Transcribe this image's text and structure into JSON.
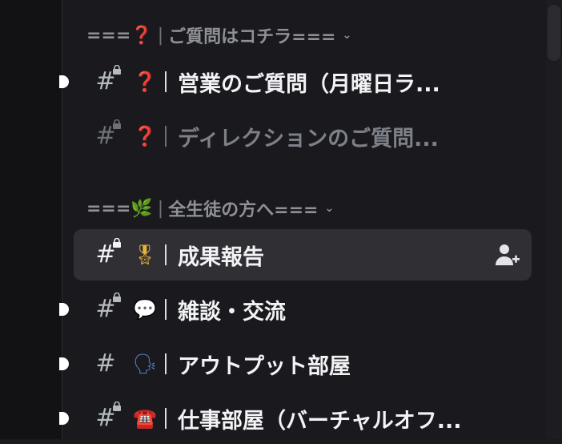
{
  "categories": [
    {
      "prefix": "===",
      "emoji": "❓",
      "separator": "|",
      "title": "ご質問はコチラ===",
      "chevron": "chevron-down"
    },
    {
      "prefix": "===",
      "emoji": "🌿",
      "separator": "|",
      "title": "全生徒の方へ===",
      "chevron": "chevron-down"
    }
  ],
  "channels": [
    {
      "hash": "#",
      "emoji": "❓",
      "separator": "|",
      "name": "営業のご質問（月曜日ラ...",
      "unread": true,
      "locked": true
    },
    {
      "hash": "#",
      "emoji": "❓",
      "separator": "|",
      "name": "ディレクションのご質問...",
      "unread": false,
      "locked": true,
      "muted": true
    },
    {
      "hash": "#",
      "emoji": "🎖",
      "separator": "|",
      "name": "成果報告",
      "unread": false,
      "locked": true,
      "selected": true,
      "icon": "add-member-icon"
    },
    {
      "hash": "#",
      "emoji": "💬",
      "separator": "|",
      "name": "雑談・交流",
      "unread": true,
      "locked": true
    },
    {
      "hash": "#",
      "emoji": "🗣",
      "separator": "|",
      "name": "アウトプット部屋",
      "unread": true,
      "locked": false
    },
    {
      "hash": "#",
      "emoji": "☎️",
      "separator": "|",
      "name": "仕事部屋（バーチャルオフ...",
      "unread": true,
      "locked": true
    }
  ],
  "colors": {
    "background": "#1a1a1e",
    "selected": "#2f2f34",
    "text": "#f2f3f5",
    "muted": "#7d8088",
    "category": "#8e9297"
  }
}
